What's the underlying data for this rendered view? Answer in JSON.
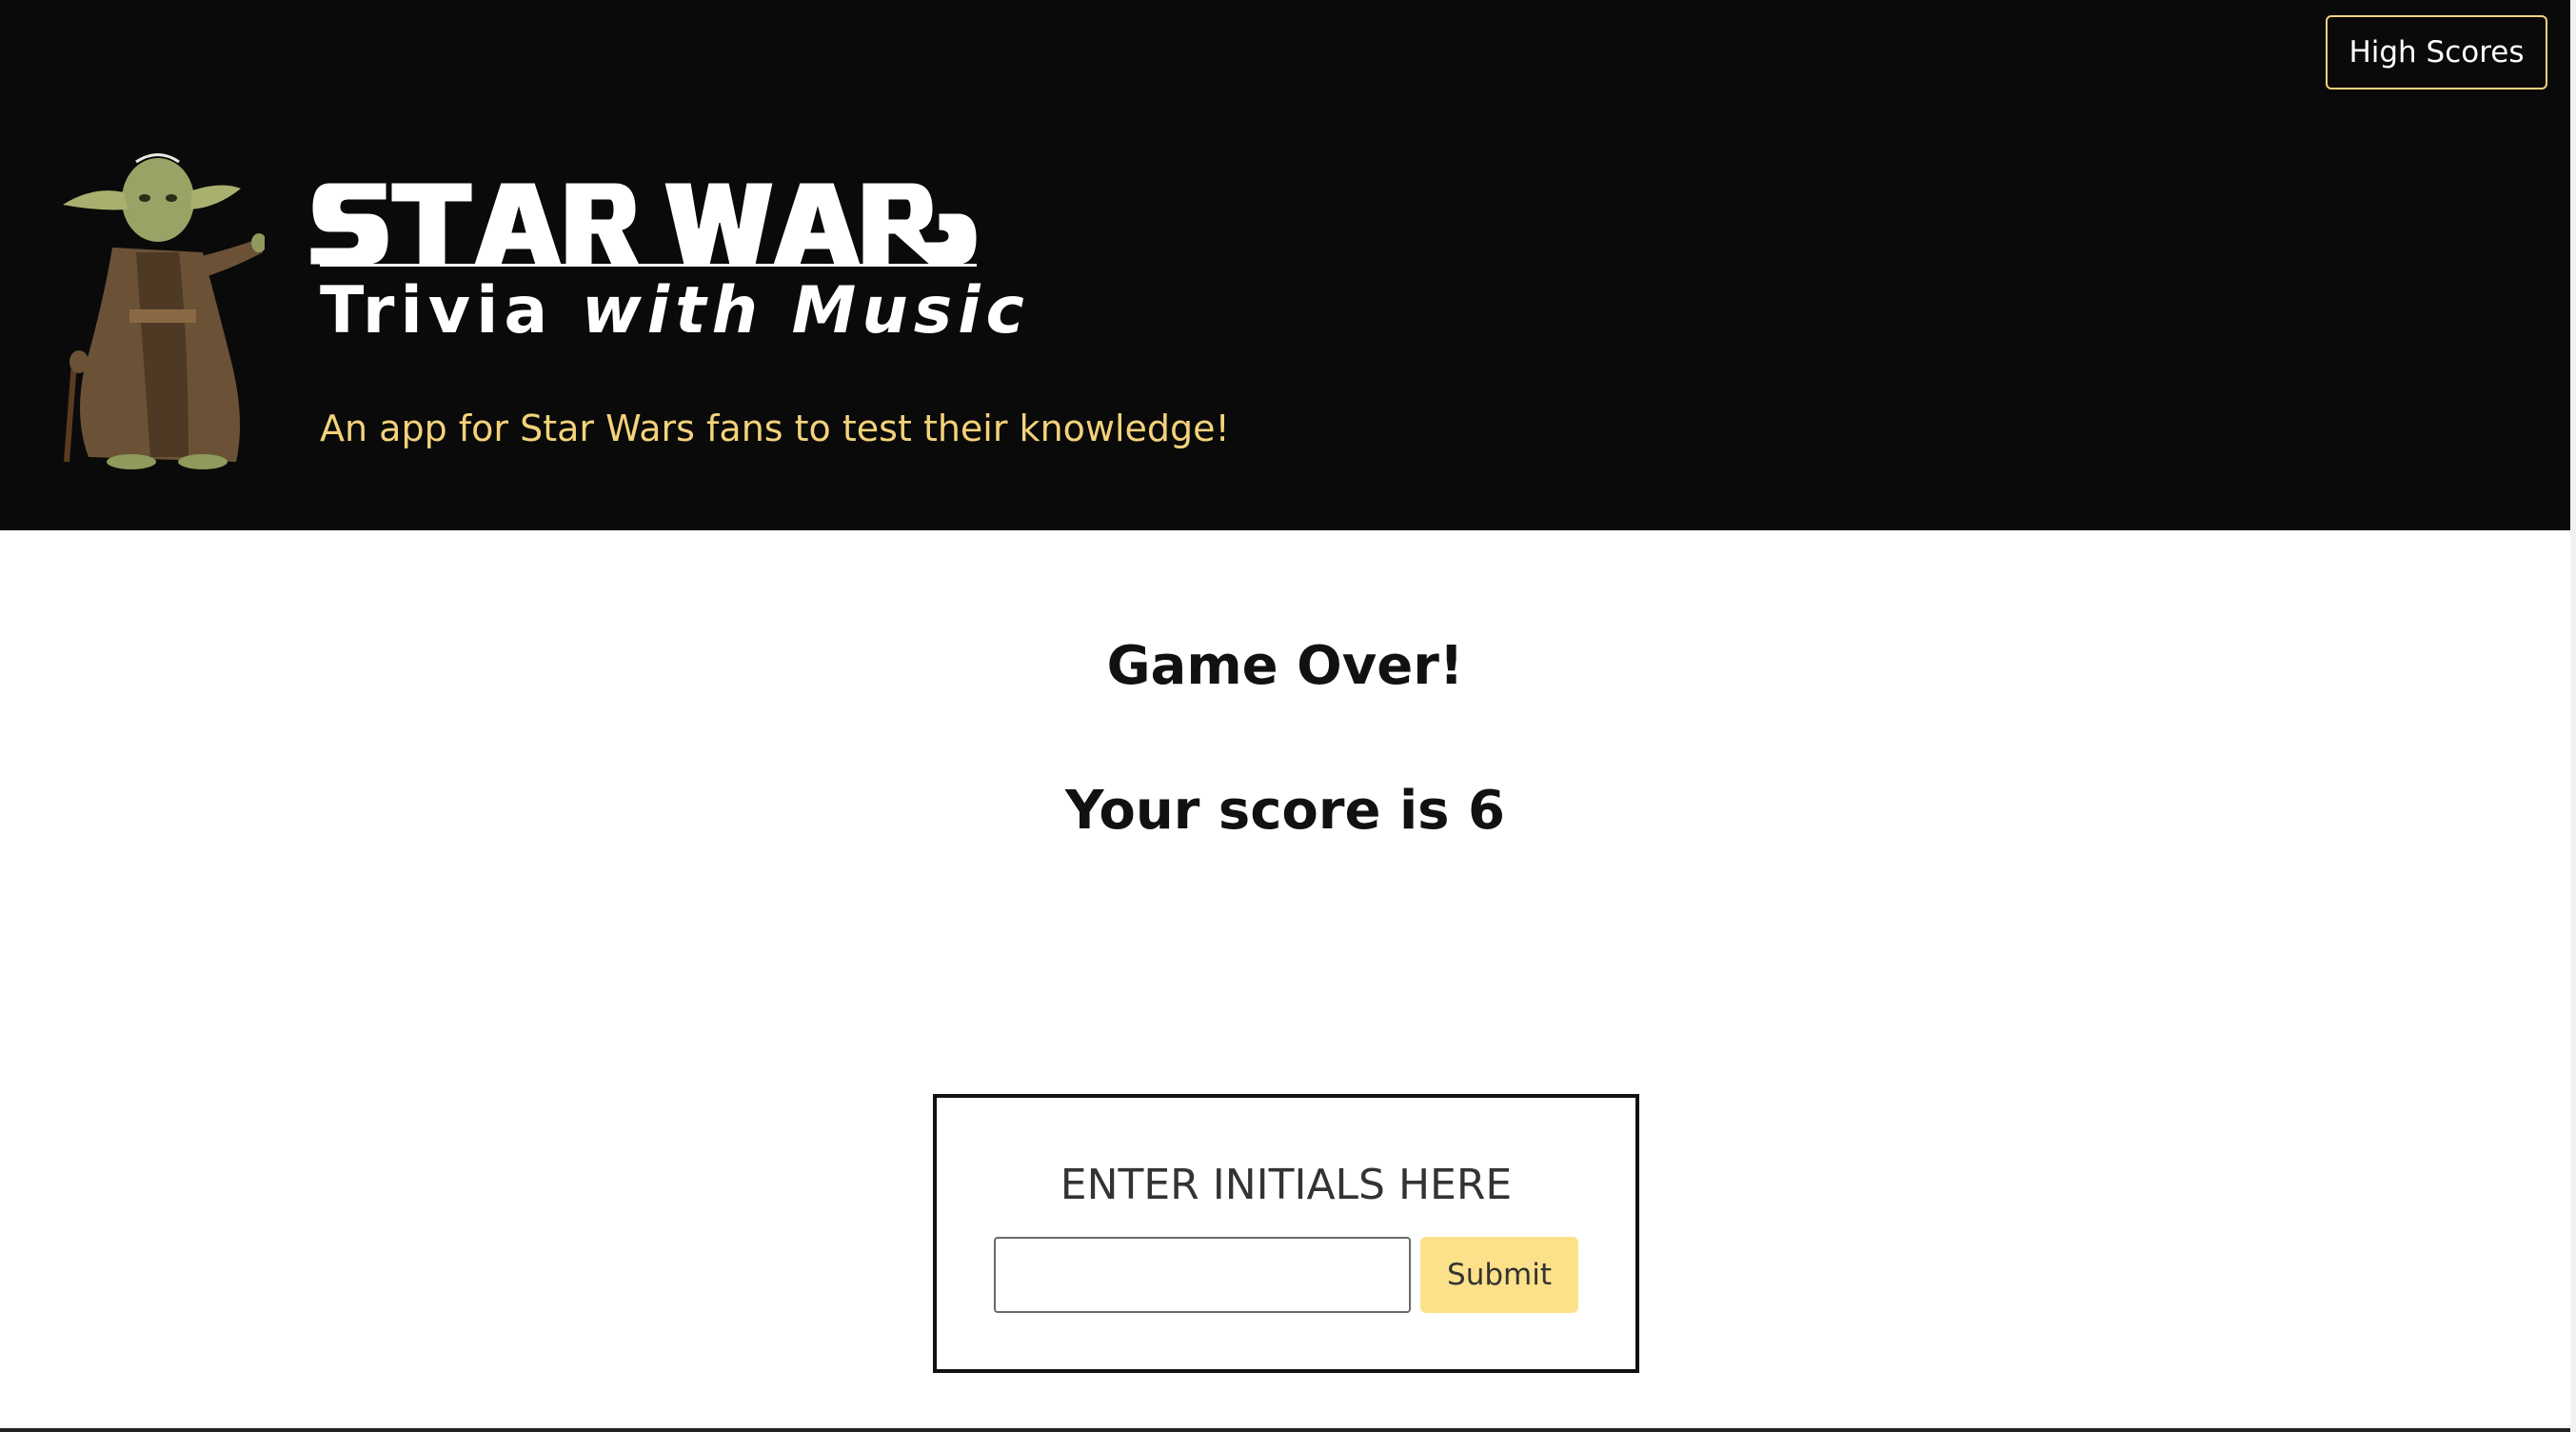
{
  "header": {
    "high_scores_label": "High Scores",
    "logo_title": "STAR WARS",
    "logo_subtitle_plain": "Trivia ",
    "logo_subtitle_italic": "with Music",
    "tagline": "An app for Star Wars fans to test their knowledge!"
  },
  "main": {
    "game_over": "Game Over!",
    "score_text": "Your score is 6"
  },
  "initials_form": {
    "label": "ENTER INITIALS HERE",
    "input_value": "",
    "input_placeholder": "",
    "submit_label": "Submit"
  },
  "colors": {
    "header_bg": "#0a0a0a",
    "accent_yellow": "#f3d27a",
    "submit_bg": "#fde18a",
    "text_dark": "#111111"
  },
  "icons": {
    "mascot": "yoda-figure"
  }
}
